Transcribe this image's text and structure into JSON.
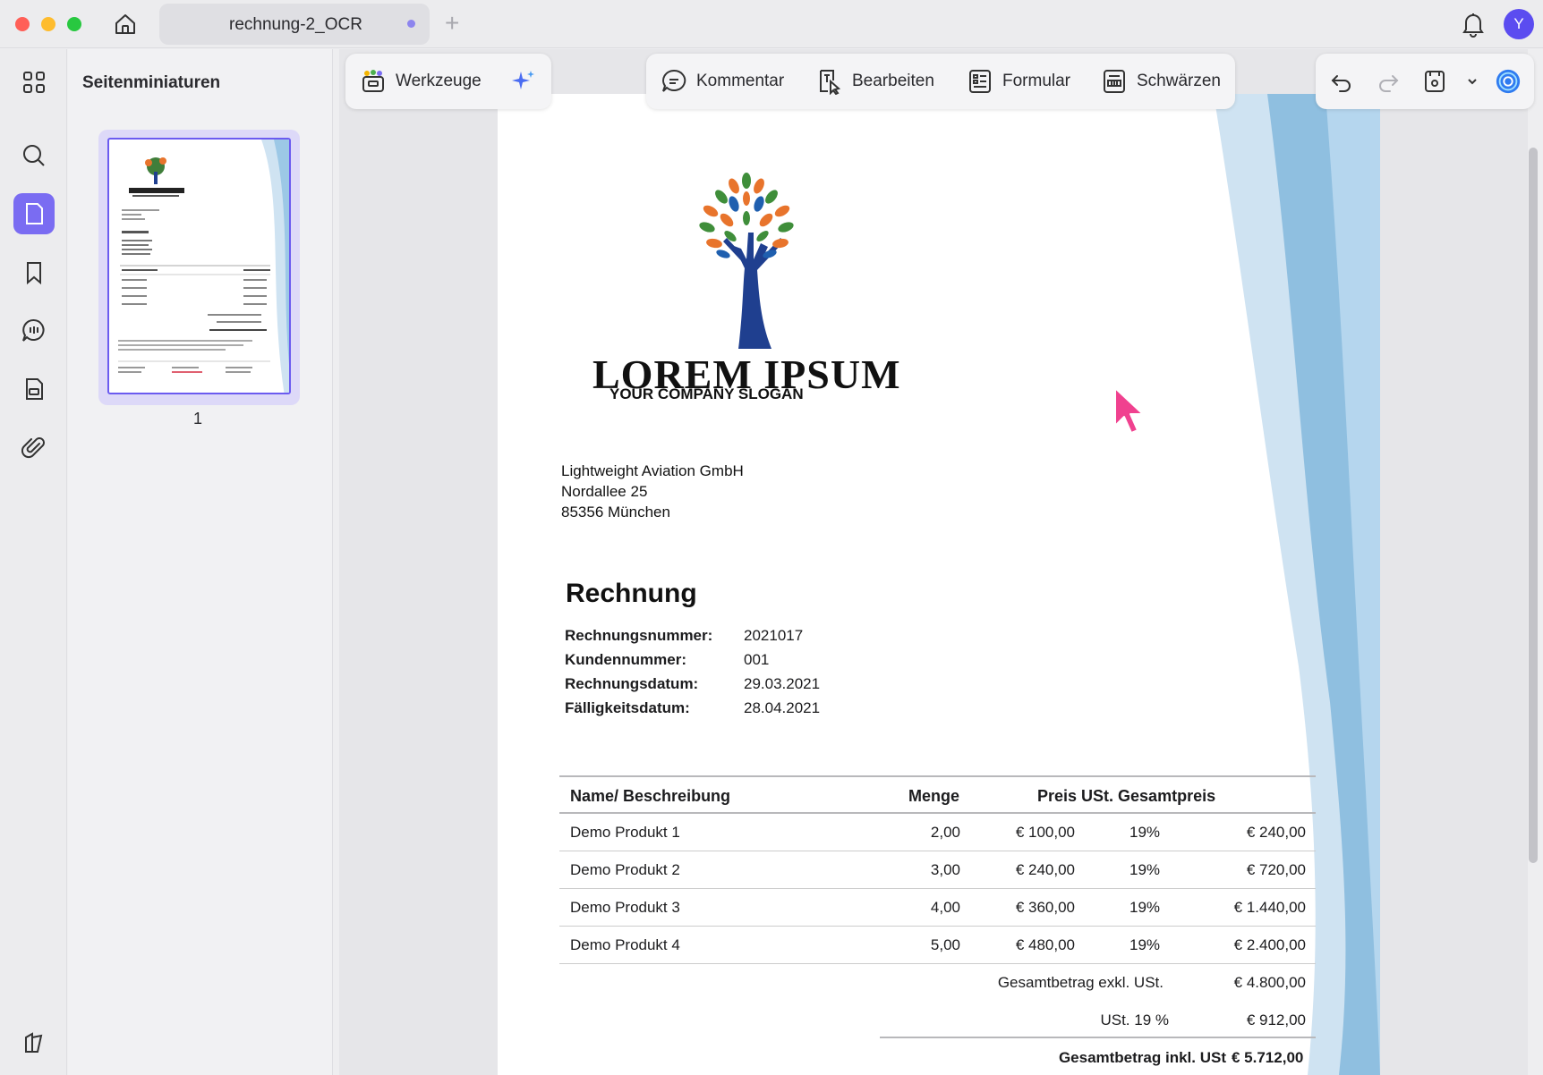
{
  "tab": {
    "title": "rechnung-2_OCR"
  },
  "user": {
    "initial": "Y"
  },
  "thumbnails": {
    "panel_title": "Seitenminiaturen",
    "page_number": "1"
  },
  "toolbar": {
    "tools_label": "Werkzeuge",
    "comment_label": "Kommentar",
    "edit_label": "Bearbeiten",
    "form_label": "Formular",
    "redact_label": "Schwärzen"
  },
  "document": {
    "logo_title": "LOREM IPSUM",
    "logo_slogan": "YOUR COMPANY SLOGAN",
    "address": [
      "Lightweight Aviation GmbH",
      "Nordallee 25",
      "85356 München"
    ],
    "heading": "Rechnung",
    "meta": [
      {
        "label": "Rechnungsnummer:",
        "value": "2021017"
      },
      {
        "label": "Kundennummer:",
        "value": "001"
      },
      {
        "label": "Rechnungsdatum:",
        "value": "29.03.2021"
      },
      {
        "label": "Fälligkeitsdatum:",
        "value": "28.04.2021"
      }
    ],
    "table": {
      "headers": {
        "name": "Name/ Beschreibung",
        "qty": "Menge",
        "price_tax_total": "Preis USt. Gesamtpreis"
      },
      "rows": [
        {
          "name": "Demo Produkt 1",
          "qty": "2,00",
          "price": "€ 100,00",
          "tax": "19%",
          "total": "€ 240,00"
        },
        {
          "name": "Demo Produkt 2",
          "qty": "3,00",
          "price": "€ 240,00",
          "tax": "19%",
          "total": "€ 720,00"
        },
        {
          "name": "Demo Produkt 3",
          "qty": "4,00",
          "price": "€ 360,00",
          "tax": "19%",
          "total": "€ 1.440,00"
        },
        {
          "name": "Demo Produkt 4",
          "qty": "5,00",
          "price": "€ 480,00",
          "tax": "19%",
          "total": "€ 2.400,00"
        }
      ]
    },
    "totals": {
      "net_label": "Gesamtbetrag exkl. USt.",
      "net_value": "€ 4.800,00",
      "tax_label": "USt. 19 %",
      "tax_value": "€ 912,00",
      "gross_label": "Gesamtbetrag inkl. USt",
      "gross_value": "€ 5.712,00"
    }
  },
  "colors": {
    "accent": "#7a6cf2",
    "avatar": "#5b4cf0",
    "wave_dark": "#8fbfe0",
    "wave_light": "#cfe3f2",
    "cursor": "#f0418f",
    "traffic_red": "#ff5f57",
    "traffic_yellow": "#febc2e",
    "traffic_green": "#28c840"
  }
}
